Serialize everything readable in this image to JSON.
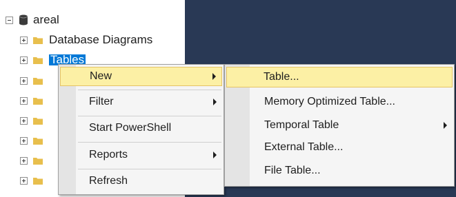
{
  "tree": {
    "database": {
      "label": "areal",
      "icon": "database-icon"
    },
    "children": [
      {
        "label": "Database Diagrams",
        "icon": "folder-icon"
      },
      {
        "label": "Tables",
        "icon": "folder-icon",
        "selected": true
      },
      {
        "label": "",
        "icon": "folder-icon"
      },
      {
        "label": "",
        "icon": "folder-icon"
      },
      {
        "label": "",
        "icon": "folder-icon"
      },
      {
        "label": "",
        "icon": "folder-icon"
      },
      {
        "label": "",
        "icon": "folder-icon"
      },
      {
        "label": "",
        "icon": "folder-icon"
      }
    ]
  },
  "context_menu": {
    "items": [
      {
        "label": "New",
        "submenu": true,
        "highlighted": true
      },
      {
        "label": "Filter",
        "submenu": true
      },
      {
        "label": "Start PowerShell",
        "submenu": false
      },
      {
        "label": "Reports",
        "submenu": true
      },
      {
        "label": "Refresh",
        "submenu": false
      }
    ]
  },
  "new_submenu": {
    "items": [
      {
        "label": "Table...",
        "submenu": false,
        "highlighted": true
      },
      {
        "label": "Memory Optimized Table...",
        "submenu": false
      },
      {
        "label": "Temporal Table",
        "submenu": true
      },
      {
        "label": "External Table...",
        "submenu": false
      },
      {
        "label": "File Table...",
        "submenu": false
      }
    ]
  },
  "colors": {
    "document_area": "#293955",
    "selection": "#0078d7",
    "menu_highlight": "#fcf0a5",
    "folder": "#e8bf4d"
  }
}
